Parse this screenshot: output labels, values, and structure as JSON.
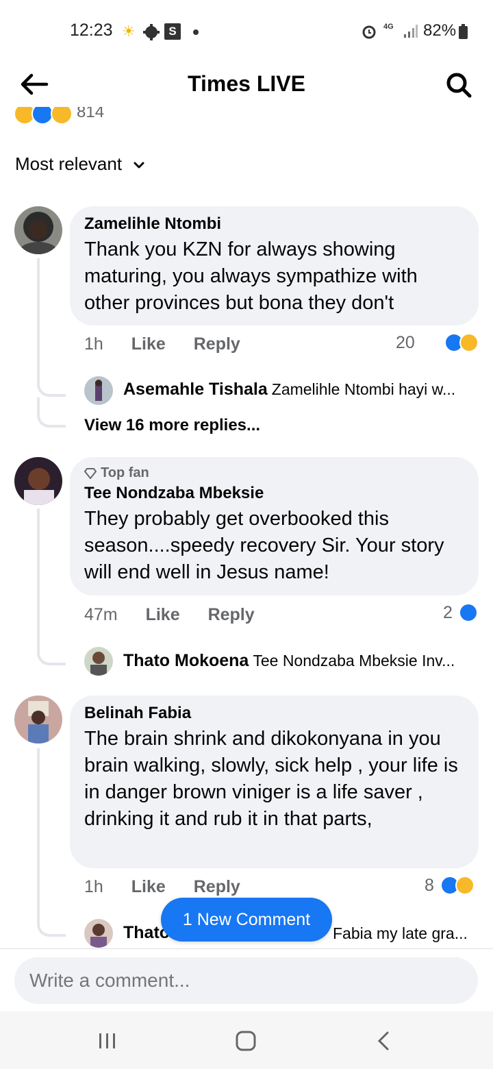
{
  "status_bar": {
    "time": "12:23",
    "battery": "82%",
    "network": "4G"
  },
  "header": {
    "title": "Times LIVE"
  },
  "reactions": {
    "count": "814"
  },
  "sort": {
    "label": "Most relevant"
  },
  "comments": [
    {
      "author": "Zamelihle Ntombi",
      "text": "Thank you KZN for always showing maturing, you always sympathize with other provinces but bona they don't",
      "time": "1h",
      "like": "Like",
      "reply": "Reply",
      "reactions": "20",
      "reply_preview": {
        "author": "Asemahle Tishala",
        "text": "Zamelihle Ntombi hayi w..."
      },
      "more_replies": "View 16 more replies..."
    },
    {
      "badge": "Top fan",
      "author": "Tee Nondzaba Mbeksie",
      "text": "They probably get overbooked this season....speedy recovery Sir. Your story will end well in Jesus name!",
      "time": "47m",
      "like": "Like",
      "reply": "Reply",
      "reactions": "2",
      "reply_preview": {
        "author": "Thato Mokoena",
        "text": "Tee Nondzaba Mbeksie Inv..."
      }
    },
    {
      "author": "Belinah Fabia",
      "text": "The brain shrink and dikokonyana in you brain  walking, slowly,  sick help , your life is in danger  brown viniger is a life saver , drinking it and rub it in that parts,",
      "time": "1h",
      "like": "Like",
      "reply": "Reply",
      "reactions": "8",
      "reply_preview": {
        "author": "Thato",
        "text": "Fabia my late gra..."
      }
    }
  ],
  "new_comment": "1 New Comment",
  "composer": {
    "placeholder": "Write a comment..."
  },
  "colors": {
    "accent": "#1877f2",
    "bubble": "#f0f2f5",
    "muted": "#65676b"
  }
}
